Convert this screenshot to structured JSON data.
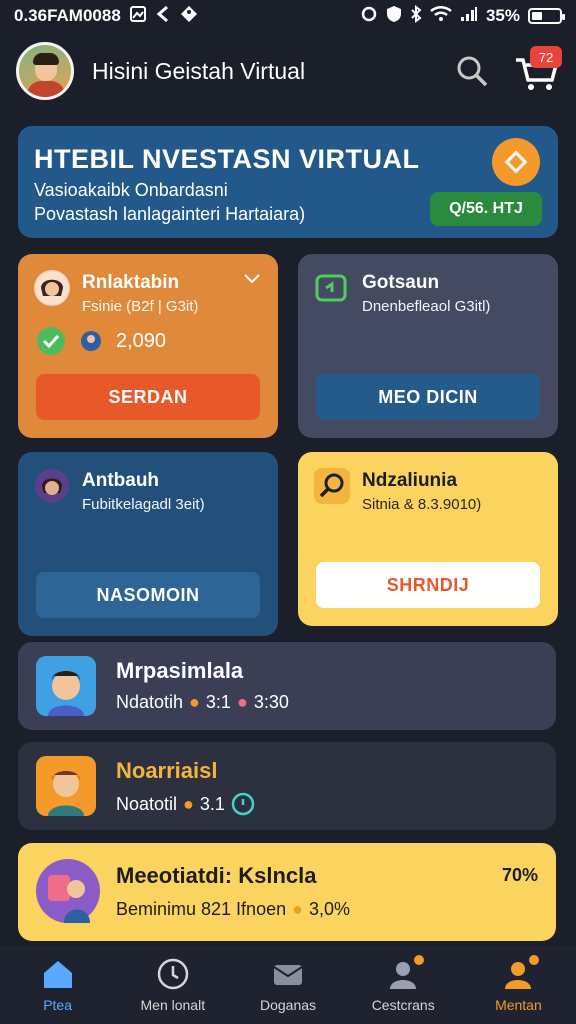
{
  "status_bar": {
    "time_text": "0.36FAM0088",
    "battery": "35%"
  },
  "header": {
    "title": "Hisini Geistah Virtual",
    "cart_count": "72"
  },
  "hero": {
    "title": "HTEBIL NVESTASN VIRTUAL",
    "line1": "Vasioakaibk Onbardasni",
    "line2": "Povastash lanlagainteri Hartaiara)",
    "pill": "Q/56. HTJ"
  },
  "tiles": [
    {
      "title": "Rnlaktabin",
      "sub": "Fsinie (B2f | G3it)",
      "value": "2,090",
      "button": "SERDAN"
    },
    {
      "title": "Gotsaun",
      "sub": "Dnenbefleaol G3itl)",
      "button": "MEO DICIN"
    },
    {
      "title": "Antbauh",
      "sub": "Fubitkelagadl 3eit)",
      "button": "NASOMOIN"
    },
    {
      "title": "Ndzaliunia",
      "sub": "Sitnia & 8.3.9010)",
      "button": "SHRNDIJ"
    }
  ],
  "rows": [
    {
      "title": "Mrpasimlala",
      "sub_a": "Ndatotih",
      "sub_b": "3:1",
      "sub_c": "3:30"
    },
    {
      "title": "Noarriaisl",
      "sub_a": "Noatotil",
      "sub_b": "3.1",
      "sub_c": ""
    },
    {
      "title": "Meeotiatdi: Kslncla",
      "sub_a": "Beminimu 821 Ifnoen",
      "sub_b": "3,0%",
      "right": "70%"
    }
  ],
  "nav": [
    {
      "label": "Ptea",
      "icon": "home-icon"
    },
    {
      "label": "Men lonalt",
      "icon": "clock-icon"
    },
    {
      "label": "Doganas",
      "icon": "mail-icon"
    },
    {
      "label": "Cestcrans",
      "icon": "person-icon"
    },
    {
      "label": "Mentan",
      "icon": "person-icon"
    }
  ],
  "colors": {
    "background": "#1b1f29",
    "hero": "#22598a",
    "orange": "#e0893a",
    "yellow": "#fbd460",
    "accent_blue": "#5aa9ff",
    "accent_orange": "#f39a2b"
  }
}
